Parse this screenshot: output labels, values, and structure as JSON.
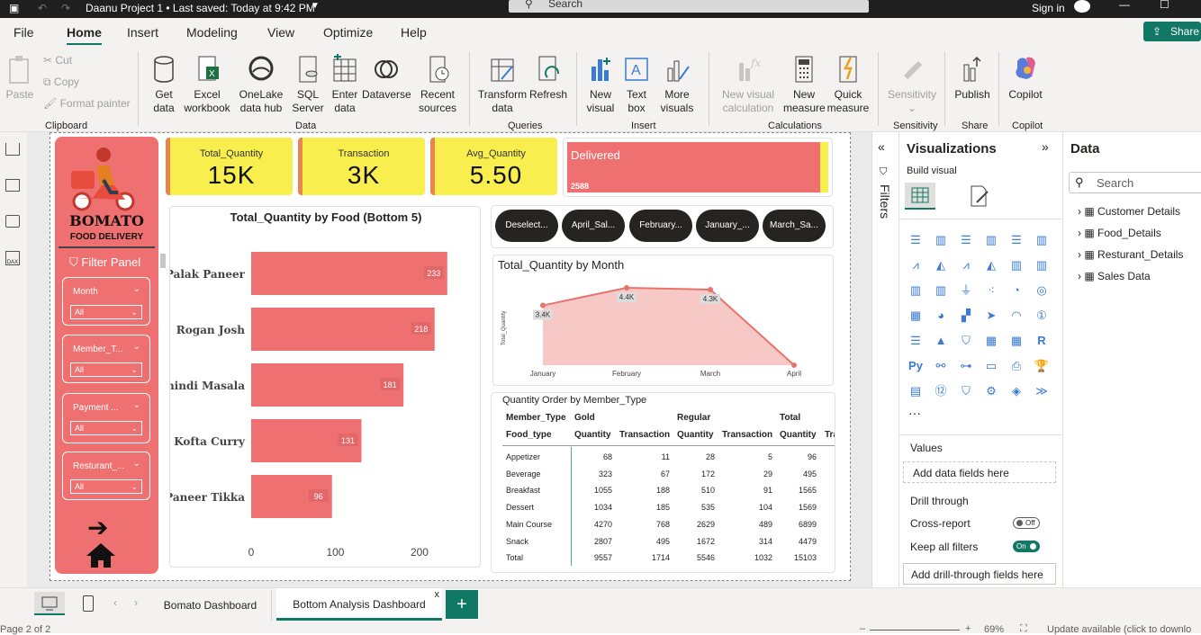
{
  "titlebar": {
    "title": "Daanu Project 1 • Last saved: Today at 9:42 PM",
    "search": "Search",
    "signin": "Sign in"
  },
  "menu": [
    "File",
    "Home",
    "Insert",
    "Modeling",
    "View",
    "Optimize",
    "Help"
  ],
  "share": "Share",
  "ribbon": {
    "clipboard": {
      "paste": "Paste",
      "cut": "Cut",
      "copy": "Copy",
      "format_painter": "Format painter",
      "group": "Clipboard"
    },
    "data": {
      "get_data": [
        "Get",
        "data"
      ],
      "excel": [
        "Excel",
        "workbook"
      ],
      "onelake": [
        "OneLake",
        "data hub"
      ],
      "sql": [
        "SQL",
        "Server"
      ],
      "enter": [
        "Enter",
        "data"
      ],
      "dataverse": "Dataverse",
      "recent": [
        "Recent",
        "sources"
      ],
      "group": "Data"
    },
    "queries": {
      "transform": [
        "Transform",
        "data"
      ],
      "refresh": "Refresh",
      "group": "Queries"
    },
    "insert": {
      "new_visual": [
        "New",
        "visual"
      ],
      "text_box": [
        "Text",
        "box"
      ],
      "more_visuals": [
        "More",
        "visuals"
      ],
      "group": "Insert"
    },
    "calculations": {
      "new_visual_calc": [
        "New visual",
        "calculation"
      ],
      "new_measure": [
        "New",
        "measure"
      ],
      "quick_measure": [
        "Quick",
        "measure"
      ],
      "group": "Calculations"
    },
    "sensitivity": {
      "label": "Sensitivity",
      "group": "Sensitivity"
    },
    "share": {
      "publish": "Publish",
      "group": "Share"
    },
    "copilot": {
      "label": "Copilot",
      "group": "Copilot"
    }
  },
  "report": {
    "brand": "BOMATO",
    "brand_sub": "FOOD DELIVERY",
    "filter_panel": "Filter Panel",
    "slicers": [
      {
        "label": "Month",
        "value": "All"
      },
      {
        "label": "Member_T...",
        "value": "All"
      },
      {
        "label": "Payment ...",
        "value": "All"
      },
      {
        "label": "Resturant_...",
        "value": "All"
      }
    ],
    "kpis": [
      {
        "title": "Total_Quantity",
        "value": "15K"
      },
      {
        "title": "Transaction",
        "value": "3K"
      },
      {
        "title": "Avg_Quantity",
        "value": "5.50"
      }
    ],
    "delivered": {
      "label": "Delivered",
      "value": "2588",
      "fraction": 0.97
    },
    "pills": [
      "Deselect...",
      "April_Sal...",
      "February...",
      "January_...",
      "March_Sa..."
    ],
    "line_title": "Total_Quantity by Month",
    "bar_title": "Total_Quantity by Food (Bottom 5)",
    "matrix": {
      "title": "Quantity Order by Member_Type",
      "group_headers": [
        "Member_Type",
        "Gold",
        "Regular",
        "Total"
      ],
      "columns": [
        "Food_type",
        "Quantity",
        "Transaction",
        "Quantity",
        "Transaction",
        "Quantity",
        "Tra"
      ],
      "rows": [
        [
          "Appetizer",
          "68",
          "11",
          "28",
          "5",
          "96"
        ],
        [
          "Beverage",
          "323",
          "67",
          "172",
          "29",
          "495"
        ],
        [
          "Breakfast",
          "1055",
          "188",
          "510",
          "91",
          "1565"
        ],
        [
          "Dessert",
          "1034",
          "185",
          "535",
          "104",
          "1569"
        ],
        [
          "Main Course",
          "4270",
          "768",
          "2629",
          "489",
          "6899"
        ],
        [
          "Snack",
          "2807",
          "495",
          "1672",
          "314",
          "4479"
        ],
        [
          "Total",
          "9557",
          "1714",
          "5546",
          "1032",
          "15103"
        ]
      ]
    }
  },
  "chart_data": [
    {
      "type": "bar",
      "title": "Total_Quantity by Food (Bottom 5)",
      "categories": [
        "Palak Paneer",
        "Rogan Josh",
        "Bhindi Masala",
        "Kofta Curry",
        "Paneer Tikka"
      ],
      "values": [
        233,
        218,
        181,
        131,
        96
      ],
      "xlim": [
        0,
        230
      ],
      "xticks": [
        "0",
        "100",
        "200"
      ],
      "color": "#ef7070"
    },
    {
      "type": "area",
      "title": "Total_Quantity by Month",
      "categories": [
        "January",
        "February",
        "March",
        "April"
      ],
      "values": [
        3.4,
        4.4,
        4.3,
        0.0
      ],
      "labels": [
        "3.4K",
        "4.4K",
        "4.3K",
        ""
      ],
      "ylabel": "Total_Quantity",
      "color": "#e8726d"
    }
  ],
  "tabs": {
    "page1": "Bomato Dashboard",
    "page2": "Bottom Analysis Dashboard",
    "add": "+",
    "close": "x"
  },
  "status": {
    "page": "Page 2 of 2",
    "zoom": "69%",
    "update": "Update available (click to downlo"
  },
  "panes": {
    "filters": "Filters",
    "viz_title": "Visualizations",
    "build": "Build visual",
    "values": "Values",
    "add_data": "Add data fields here",
    "drill": "Drill through",
    "cross": "Cross-report",
    "cross_state": "Off",
    "keep": "Keep all filters",
    "keep_state": "On",
    "add_drill": "Add drill-through fields here",
    "data_title": "Data",
    "search": "Search",
    "tables": [
      "Customer Details",
      "Food_Details",
      "Resturant_Details",
      "Sales Data"
    ]
  }
}
